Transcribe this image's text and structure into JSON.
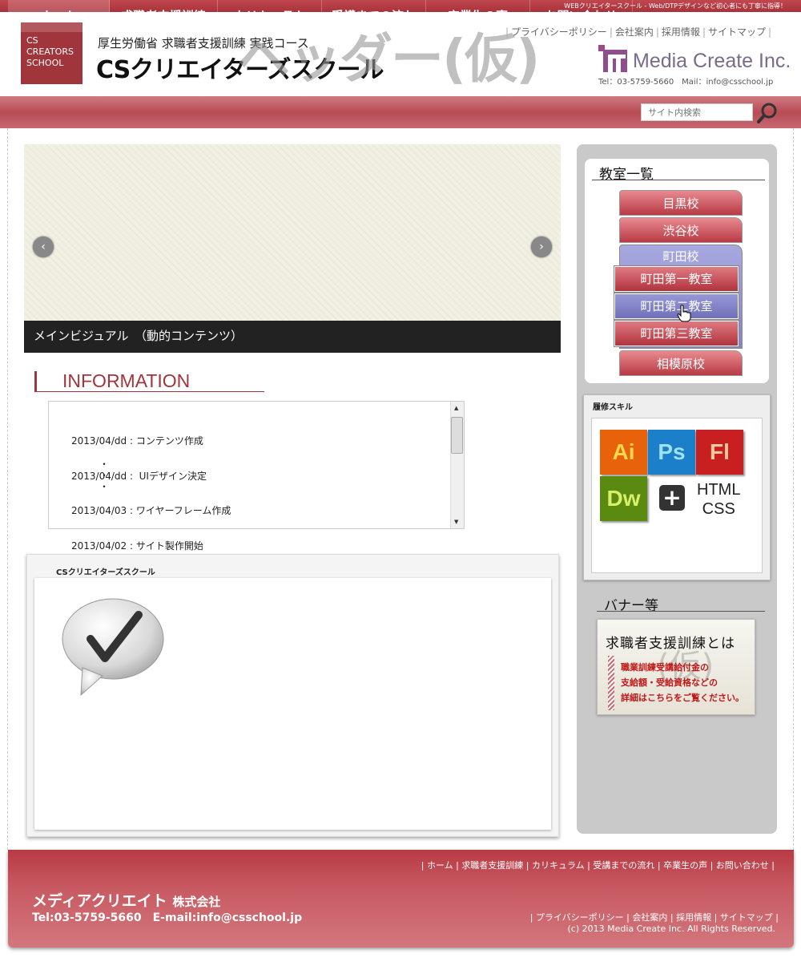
{
  "topbar": {
    "tagline": "WEBクリエイタースクール - Web/DTPデザインなど初心者にも丁寧に指導！"
  },
  "header": {
    "logo_text": "CS\nCREATORS\nSCHOOL",
    "subtitle": "厚生労働省 求職者支援訓練 実践コース",
    "title": "CSクリエイターズスクール",
    "watermark": "ヘッダー(仮)",
    "links": [
      "プライバシーポリシー",
      "会社案内",
      "採用情報",
      "サイトマップ"
    ],
    "company_logo_name": "Media Create Inc.",
    "contact": "Tel：03-5759-5660　Mail：info@csschool.jp"
  },
  "nav": {
    "items": [
      "ホーム",
      "求職者支援訓練",
      "カリキュラム",
      "受講までの流れ",
      "卒業生の声",
      "お問い合わせ"
    ],
    "active_index": 0,
    "search_placeholder": "サイト内検索"
  },
  "slider": {
    "caption": "メインビジュアル　（動的コンテンツ）",
    "prev_icon": "‹",
    "next_icon": "›"
  },
  "information": {
    "title": "INFORMATION",
    "entries": [
      {
        "date": "2013/04/dd",
        "text": "コンテンツ作成"
      },
      {
        "date": "2013/04/dd",
        "text": " UIデザイン決定"
      },
      {
        "date": "2013/04/03",
        "text": "ワイヤーフレーム作成"
      },
      {
        "date": "2013/04/02",
        "text": "サイト製作開始"
      }
    ],
    "ellipsis": "・\n・\n・"
  },
  "school_panel": {
    "title": "CSクリエイターズスクール"
  },
  "sidebar": {
    "classrooms_title": "教室一覧",
    "schools": [
      "目黒校",
      "渋谷校",
      "町田校",
      "相模原校"
    ],
    "machida_rooms": [
      "町田第一教室",
      "町田第二教室",
      "町田第三教室"
    ],
    "skills_title": "履修スキル",
    "skills": [
      {
        "label": "Ai",
        "bg": "#e8620c",
        "fg": "#ffd84a"
      },
      {
        "label": "Ps",
        "bg": "#1b7fc9",
        "fg": "#9fe2ff"
      },
      {
        "label": "Fl",
        "bg": "#c82020",
        "fg": "#ffc7a0"
      },
      {
        "label": "Dw",
        "bg": "#5a8a10",
        "fg": "#d6f06a"
      }
    ],
    "plus": "+",
    "html_css": "HTML\nCSS",
    "banners_title": "バナー等",
    "banner": {
      "title": "求職者支援訓練とは",
      "watermark": "(仮)",
      "body": "職業訓練受講給付金の\n支給額・受給資格などの\n詳細はこちらをご覧ください。"
    }
  },
  "footer": {
    "nav": [
      "ホーム",
      "求職者支援訓練",
      "カリキュラム",
      "受講までの流れ",
      "卒業生の声",
      "お問い合わせ"
    ],
    "company": "メディアクリエイト",
    "company_suffix": "株式会社",
    "contact": "Tel:03-5759-5660　E-mail:info@csschool.jp",
    "links": [
      "プライバシーポリシー",
      "会社案内",
      "採用情報",
      "サイトマップ"
    ],
    "copyright": "(c) 2013 Media Create Inc. All Rights Reserved."
  },
  "colors": {
    "brand": "#a0353c",
    "nav": "#c05a62",
    "hover": "#8484c8"
  }
}
